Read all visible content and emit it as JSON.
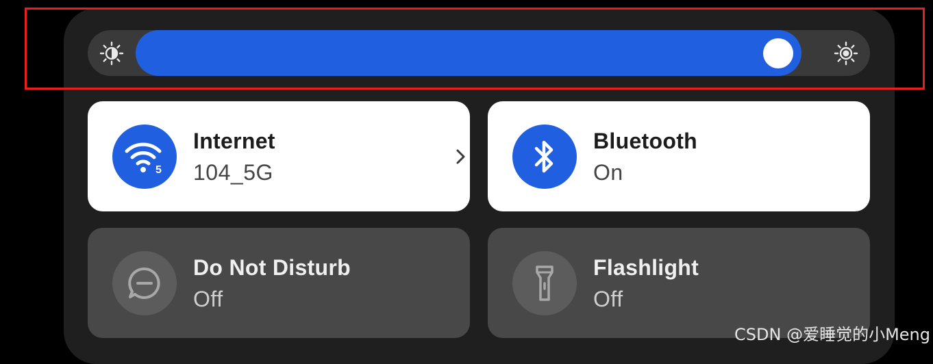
{
  "brightness": {
    "level": 0.97,
    "min_icon": "brightness-low-icon",
    "max_icon": "brightness-high-icon",
    "accent_color": "#1f5fe0",
    "highlight_color": "#e81f1f"
  },
  "tiles": [
    {
      "title": "Internet",
      "subtitle": "104_5G",
      "state": "on",
      "icon": "wifi-5-icon",
      "wifi_badge": "5",
      "has_chevron": true
    },
    {
      "title": "Bluetooth",
      "subtitle": "On",
      "state": "on",
      "icon": "bluetooth-icon"
    },
    {
      "title": "Do Not Disturb",
      "subtitle": "Off",
      "state": "off",
      "icon": "do-not-disturb-icon"
    },
    {
      "title": "Flashlight",
      "subtitle": "Off",
      "state": "off",
      "icon": "flashlight-icon"
    }
  ],
  "watermark": "CSDN @爱睡觉的小Meng"
}
